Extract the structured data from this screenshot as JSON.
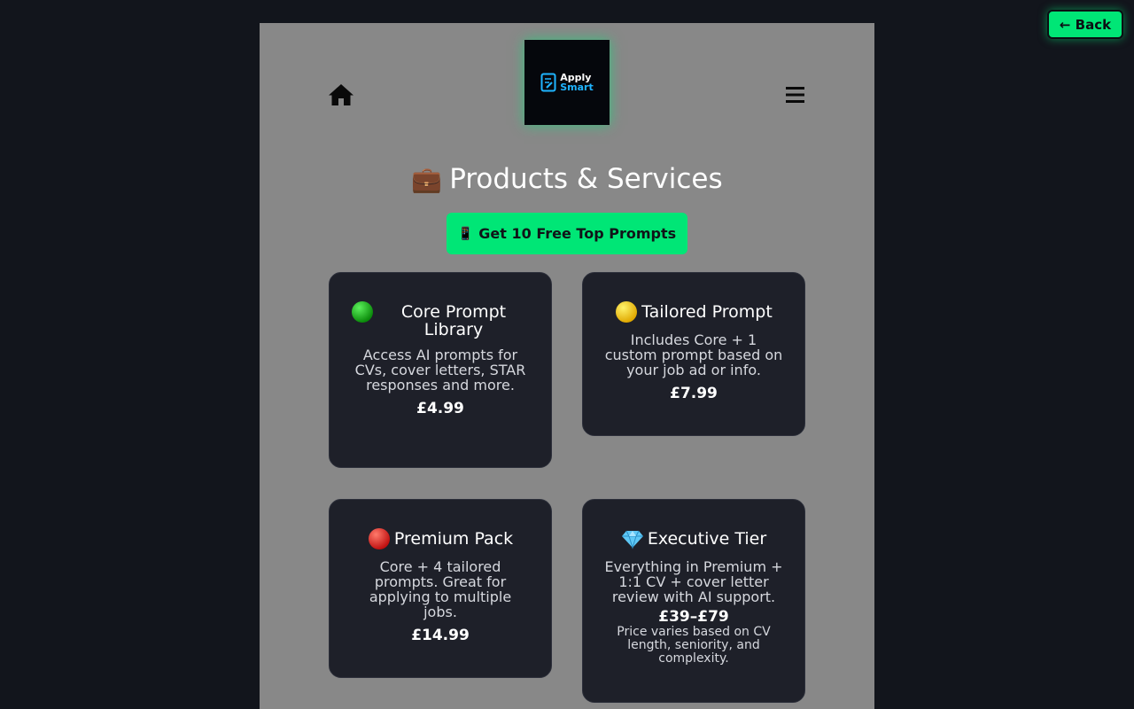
{
  "back_button": {
    "label": "← Back"
  },
  "header": {
    "home_icon": "home-icon",
    "menu_icon": "hamburger-menu-icon",
    "logo": {
      "line1": "Apply",
      "line2": "Smart"
    }
  },
  "main": {
    "title_icon": "💼",
    "title": "Products & Services",
    "cta": {
      "icon": "📱",
      "label": "Get 10 Free Top Prompts"
    }
  },
  "products": [
    {
      "icon": "green-circle-icon",
      "title": "Core Prompt Library",
      "desc": "Access AI prompts for CVs, cover letters, STAR responses and more.",
      "price": "£4.99"
    },
    {
      "icon": "yellow-circle-icon",
      "title": "Tailored Prompt",
      "desc": "Includes Core + 1 custom prompt based on your job ad or info.",
      "price": "£7.99"
    },
    {
      "icon": "red-circle-icon",
      "title": "Premium Pack",
      "desc": "Core + 4 tailored prompts. Great for applying to multiple jobs.",
      "price": "£14.99"
    },
    {
      "icon": "diamond-icon",
      "title": "Executive Tier",
      "desc": "Everything in Premium + 1:1 CV + cover letter review with AI support.",
      "price": "£39–£79",
      "note": "Price varies based on CV length, seniority, and complexity."
    }
  ],
  "colors": {
    "accent": "#00e676",
    "page_bg": "#888888",
    "card_bg": "#1e2029",
    "body_bg": "#12151c"
  }
}
